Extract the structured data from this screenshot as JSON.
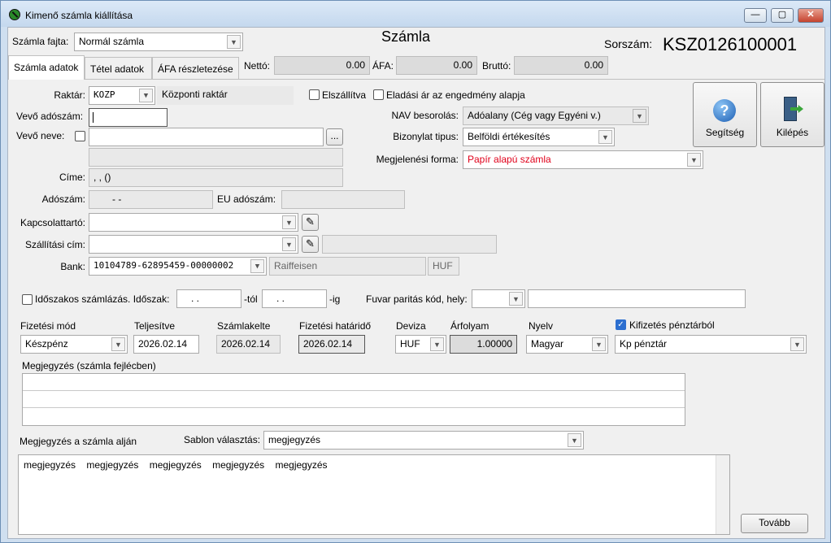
{
  "window": {
    "title": "Kimenő számla kiállítása",
    "min": "—",
    "max": "▢",
    "close": "✕"
  },
  "header": {
    "type_label": "Számla fajta:",
    "type_value": "Normál számla",
    "title": "Számla",
    "serial_label": "Sorszám:",
    "serial_value": "KSZ0126100001"
  },
  "tabs": [
    "Számla adatok",
    "Tétel adatok",
    "ÁFA részletezése"
  ],
  "totals": {
    "net_label": "Nettó:",
    "net_value": "0.00",
    "vat_label": "ÁFA:",
    "vat_value": "0.00",
    "gross_label": "Bruttó:",
    "gross_value": "0.00"
  },
  "warehouse": {
    "label": "Raktár:",
    "code": "KOZP",
    "name": "Központi raktár"
  },
  "checks": {
    "shipped": "Elszállítva",
    "discount": "Eladási ár az engedmény alapja"
  },
  "nav": {
    "label": "NAV besorolás:",
    "value": "Adóalany (Cég vagy Egyéni v.)"
  },
  "doc_type": {
    "label": "Bizonylat tipus:",
    "value": "Belföldi értékesítés"
  },
  "appearance": {
    "label": "Megjelenési forma:",
    "value": "Papír alapú számla",
    "color": "#e0001a"
  },
  "help": {
    "label": "Segítség",
    "icon": "help-icon"
  },
  "exit": {
    "label": "Kilépés",
    "icon": "exit-door-icon"
  },
  "buyer": {
    "tax_label": "Vevő adószám:",
    "tax_value": "",
    "name_label": "Vevő neve:",
    "name_value": "",
    "browse": "...",
    "address_label": "Címe:",
    "address_value": ", ,  ()",
    "taxnum_label": "Adószám:",
    "taxnum_value": "- -",
    "eu_label": "EU adószám:",
    "eu_value": ""
  },
  "contact": {
    "label": "Kapcsolattartó:",
    "value": ""
  },
  "shipping": {
    "label": "Szállítási cím:",
    "value": "",
    "extra": ""
  },
  "bank": {
    "label": "Bank:",
    "account": "10104789-62895459-00000002",
    "name": "Raiffeisen",
    "currency": "HUF"
  },
  "period": {
    "label": "Időszakos számlázás. Időszak:",
    "from": " .  .",
    "from_suffix": "-tól",
    "to": " .  .",
    "to_suffix": "-ig"
  },
  "freight": {
    "label": "Fuvar paritás kód, hely:",
    "code": "",
    "place": ""
  },
  "payment": {
    "method_label": "Fizetési mód",
    "method_value": "Készpénz",
    "completed_label": "Teljesítve",
    "completed_value": "2026.02.14",
    "issued_label": "Számlakelte",
    "issued_value": "2026.02.14",
    "due_label": "Fizetési határidő",
    "due_value": "2026.02.14",
    "currency_label": "Deviza",
    "currency_value": "HUF",
    "rate_label": "Árfolyam",
    "rate_value": "1.00000",
    "lang_label": "Nyelv",
    "lang_value": "Magyar",
    "cash_label": "Kifizetés pénztárból",
    "cash_value": "Kp pénztár"
  },
  "notes": {
    "header_label": "Megjegyzés (számla fejlécben)",
    "footer_label": "Megjegyzés a számla alján",
    "template_label": "Sablon választás:",
    "template_value": "megjegyzés",
    "footer_text": "megjegyzés    megjegyzés    megjegyzés    megjegyzés    megjegyzés"
  },
  "next": "Tovább"
}
